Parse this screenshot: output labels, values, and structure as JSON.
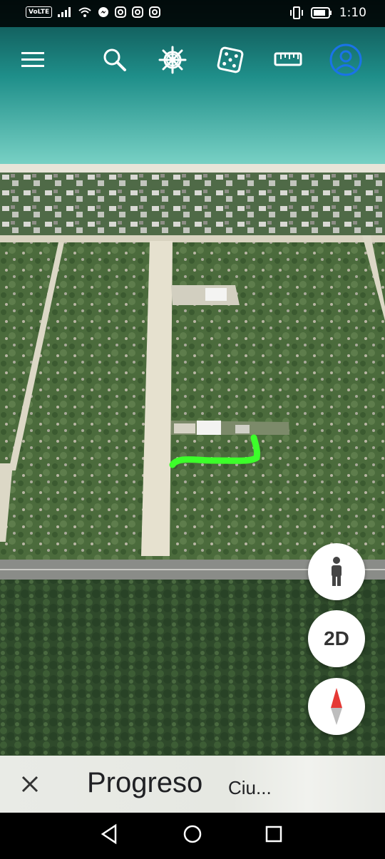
{
  "status_bar": {
    "volte_label": "VoLTE",
    "time": "1:10",
    "icons": [
      "signal-icon",
      "wifi-icon",
      "messenger-icon",
      "instagram-icon",
      "instagram-icon",
      "instagram-icon",
      "vibrate-icon",
      "battery-icon"
    ]
  },
  "toolbar": {
    "items": [
      "menu-icon",
      "search-icon",
      "voyager-icon",
      "feeling-lucky-icon",
      "measure-icon",
      "account-icon"
    ]
  },
  "map_controls": {
    "pegman": "pegman-icon",
    "view_toggle_label": "2D",
    "compass": "compass-icon"
  },
  "place_panel": {
    "title": "Progreso",
    "subtitle": "Ciu..."
  },
  "nav_bar": {
    "items": [
      "back-icon",
      "home-icon",
      "recents-icon"
    ]
  },
  "colors": {
    "accent_blue": "#1a73e8",
    "highlight_green": "#3cff2a",
    "compass_red": "#e53935"
  }
}
